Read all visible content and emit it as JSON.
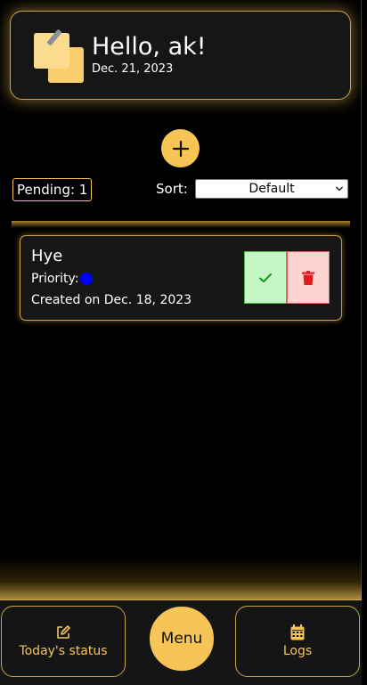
{
  "header": {
    "greeting": "Hello, ak!",
    "date": "Dec. 21, 2023",
    "logo_icon": "sticky-notes-icon"
  },
  "toolbar": {
    "add_icon": "plus-icon",
    "pending_label": "Pending: 1",
    "sort_label": "Sort:",
    "sort_selected": "Default"
  },
  "tasks": [
    {
      "title": "Hye",
      "priority_label": "Priority:",
      "priority_color": "#0000ff",
      "created": "Created on Dec. 18, 2023",
      "done_icon": "check-icon",
      "delete_icon": "trash-icon"
    }
  ],
  "nav": {
    "status_label": "Today's status",
    "status_icon": "edit-icon",
    "menu_label": "Menu",
    "logs_label": "Logs",
    "logs_icon": "calendar-icon"
  },
  "colors": {
    "accent": "#f7c456",
    "card_bg": "#161616",
    "background": "#000000",
    "done_bg": "#c6f5c6",
    "delete_bg": "#ffd3d0"
  }
}
